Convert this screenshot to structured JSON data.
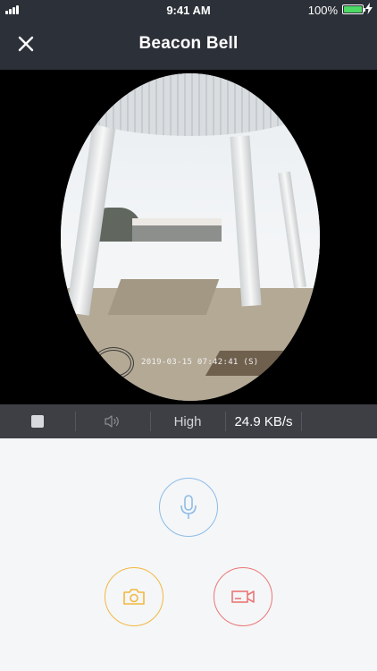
{
  "status_bar": {
    "time": "9:41 AM",
    "battery_percent": "100%",
    "battery_level": 1.0
  },
  "nav": {
    "title": "Beacon Bell",
    "close_icon": "close-icon"
  },
  "camera": {
    "timestamp": "2019-03-15 07:42:41  (S)"
  },
  "controls": {
    "stop_icon": "stop-icon",
    "speaker_icon": "speaker-icon",
    "quality_label": "High",
    "bitrate_label": "24.9 KB/s"
  },
  "actions": {
    "mic_icon": "microphone-icon",
    "photo_icon": "camera-icon",
    "video_icon": "video-camera-icon"
  },
  "colors": {
    "header_bg": "#2c3038",
    "control_bar_bg": "#3d3f44",
    "mic_accent": "#8dbce6",
    "photo_accent": "#f2b840",
    "video_accent": "#ea7775",
    "battery_fill": "#4cd964"
  }
}
